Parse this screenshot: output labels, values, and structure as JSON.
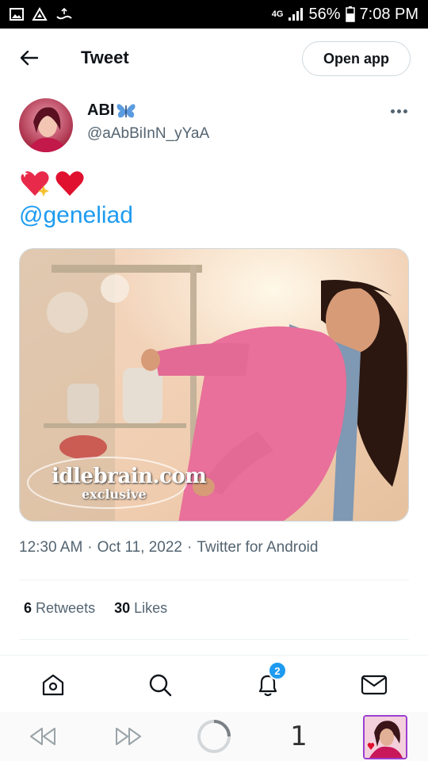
{
  "status_bar": {
    "network": "4G",
    "battery": "56%",
    "time": "7:08 PM"
  },
  "header": {
    "title": "Tweet",
    "open_app_label": "Open app"
  },
  "author": {
    "name": "ABI",
    "handle": "@aAbBiInN_yYaA"
  },
  "tweet": {
    "mention": "@geneliad",
    "media_watermark_line1": "idlebrain.com",
    "media_watermark_line2": "exclusive",
    "time": "12:30 AM",
    "date": "Oct 11, 2022",
    "source": "Twitter for Android",
    "separator": "·"
  },
  "stats": {
    "retweets_count": "6",
    "retweets_label": "Retweets",
    "likes_count": "30",
    "likes_label": "Likes"
  },
  "bottom_nav": {
    "notifications_badge": "2"
  },
  "browser_bar": {
    "tab_count": "1"
  },
  "colors": {
    "accent": "#1d9bf0",
    "text_secondary": "#536471",
    "divider": "#eff3f4"
  }
}
